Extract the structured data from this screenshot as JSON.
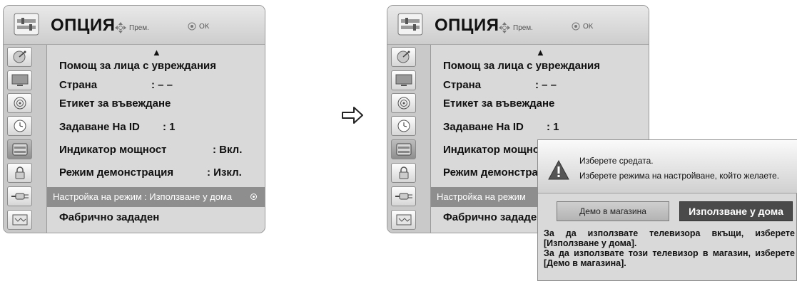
{
  "colors": {
    "panel_bg": "#d9d9d9",
    "selected_row": "#8e8e8e",
    "primary_button": "#4a4a4a"
  },
  "menu": {
    "title": "ОПЦИЯ",
    "hint_move": "Прем.",
    "hint_ok": "OK",
    "scroll_up_indicator": "▲",
    "sidebar_icons": [
      "satellite-dish-icon",
      "monitor-icon",
      "speaker-icon",
      "clock-icon",
      "option-icon",
      "lock-icon",
      "input-plug-icon",
      "usb-icon"
    ],
    "items": [
      {
        "label": "Помощ за лица с увреждания",
        "value": ""
      },
      {
        "label": "Страна",
        "value": ": – –"
      },
      {
        "label": "Етикет за въвеждане",
        "value": ""
      },
      {
        "label": "Задаване На ID",
        "value": ": 1"
      },
      {
        "label": "Индикатор мощност",
        "value": ": Вкл."
      },
      {
        "label": "Режим демонстрация",
        "value": ": Изкл."
      },
      {
        "label": "Настройка на режим",
        "value": ": Използване у дома"
      },
      {
        "label": "Фабрично зададен",
        "value": ""
      }
    ]
  },
  "right_menu": {
    "items": [
      {
        "label": "Помощ за лица с увреждания"
      },
      {
        "label": "Страна",
        "value": ": – –"
      },
      {
        "label": "Етикет за въвеждане"
      },
      {
        "label": "Задаване На ID",
        "value": ": 1"
      },
      {
        "label": "Индикатор мощнос"
      },
      {
        "label": "Режим демонстрац"
      },
      {
        "label": "Настройка на режим"
      },
      {
        "label": "Фабрично зададен"
      }
    ]
  },
  "dialog": {
    "line1": "Изберете средата.",
    "line2": "Изберете режима на настройване, който желаете.",
    "store_button": "Демо в магазина",
    "home_button": "Използване у дома",
    "help_home": "За да използвате телевизора вкъщи, изберете [Използване у дома].",
    "help_store": "За да използвате този телевизор в магазин, изберете [Демо в магазина]."
  }
}
